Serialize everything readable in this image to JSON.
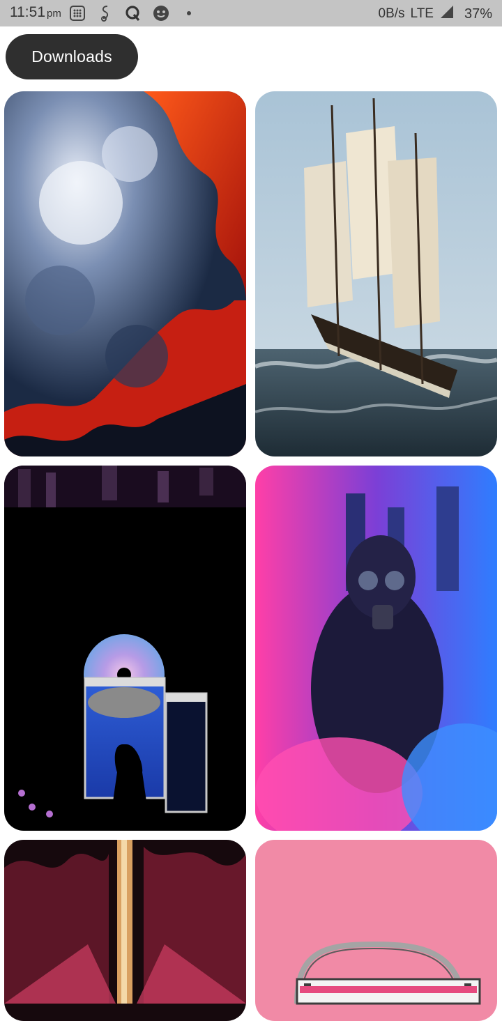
{
  "status_bar": {
    "time": "11:51",
    "ampm": "pm",
    "icons": [
      "calculator-icon",
      "swype-icon",
      "quora-icon",
      "emoji-face-icon",
      "notification-dot-icon"
    ],
    "net_speed": "0B/s",
    "network": "LTE",
    "battery": "37%"
  },
  "header": {
    "chip_label": "Downloads"
  },
  "grid": {
    "items": [
      {
        "subject": "red and blue fractal smoke"
      },
      {
        "subject": "sailing ship on stormy sea"
      },
      {
        "subject": "vaporwave silhouette with compact disc"
      },
      {
        "subject": "gas mask hoodie in pink and blue smoke"
      },
      {
        "subject": "golden sword on crimson ink"
      },
      {
        "subject": "pink radio illustration"
      }
    ]
  },
  "colors": {
    "status_bar_bg": "#c4c4c4",
    "chip_bg": "#2f2f2f",
    "page_bg": "#ffffff"
  }
}
